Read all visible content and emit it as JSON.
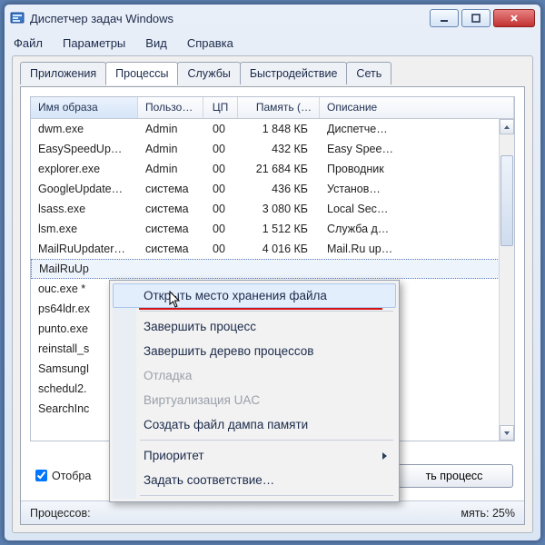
{
  "window_title": "Диспетчер задач Windows",
  "menubar": [
    "Файл",
    "Параметры",
    "Вид",
    "Справка"
  ],
  "tabs": [
    "Приложения",
    "Процессы",
    "Службы",
    "Быстродействие",
    "Сеть"
  ],
  "active_tab_index": 1,
  "columns": {
    "name": "Имя образа",
    "user": "Пользо…",
    "cpu": "ЦП",
    "mem": "Память (…",
    "desc": "Описание"
  },
  "rows": [
    {
      "name": "dwm.exe",
      "user": "Admin",
      "cpu": "00",
      "mem": "1 848 КБ",
      "desc": "Диспетче…"
    },
    {
      "name": "EasySpeedUp…",
      "user": "Admin",
      "cpu": "00",
      "mem": "432 КБ",
      "desc": "Easy Spee…"
    },
    {
      "name": "explorer.exe",
      "user": "Admin",
      "cpu": "00",
      "mem": "21 684 КБ",
      "desc": "Проводник"
    },
    {
      "name": "GoogleUpdate…",
      "user": "система",
      "cpu": "00",
      "mem": "436 КБ",
      "desc": "Установ…"
    },
    {
      "name": "lsass.exe",
      "user": "система",
      "cpu": "00",
      "mem": "3 080 КБ",
      "desc": "Local Sec…"
    },
    {
      "name": "lsm.exe",
      "user": "система",
      "cpu": "00",
      "mem": "1 512 КБ",
      "desc": "Служба д…"
    },
    {
      "name": "MailRuUpdater…",
      "user": "система",
      "cpu": "00",
      "mem": "4 016 КБ",
      "desc": "Mail.Ru up…"
    },
    {
      "name": "MailRuUp",
      "user": "",
      "cpu": "",
      "mem": "",
      "desc": ""
    },
    {
      "name": "ouc.exe *",
      "user": "",
      "cpu": "",
      "mem": "",
      "desc": ""
    },
    {
      "name": "ps64ldr.ex",
      "user": "",
      "cpu": "",
      "mem": "",
      "desc": ""
    },
    {
      "name": "punto.exe",
      "user": "",
      "cpu": "",
      "mem": "",
      "desc": ""
    },
    {
      "name": "reinstall_s",
      "user": "",
      "cpu": "",
      "mem": "",
      "desc": ""
    },
    {
      "name": "SamsungI",
      "user": "",
      "cpu": "",
      "mem": "",
      "desc": ""
    },
    {
      "name": "schedul2.",
      "user": "",
      "cpu": "",
      "mem": "",
      "desc": ""
    },
    {
      "name": "SearchInc",
      "user": "",
      "cpu": "",
      "mem": "",
      "desc": ""
    }
  ],
  "selected_row_index": 7,
  "checkbox_label": "Отобра",
  "checkbox_checked": true,
  "end_button_partial": "ть процесс",
  "status": {
    "processes": "Процессов:",
    "memory": "мять: 25%"
  },
  "context_menu": [
    {
      "label": "Открыть место хранения файла",
      "hover": true
    },
    {
      "sep": true
    },
    {
      "label": "Завершить процесс"
    },
    {
      "label": "Завершить дерево процессов"
    },
    {
      "label": "Отладка",
      "disabled": true
    },
    {
      "label": "Виртуализация UAC",
      "disabled": true
    },
    {
      "label": "Создать файл дампа памяти"
    },
    {
      "sep": true
    },
    {
      "label": "Приоритет",
      "submenu": true
    },
    {
      "label": "Задать соответствие…"
    },
    {
      "sep": true
    }
  ]
}
